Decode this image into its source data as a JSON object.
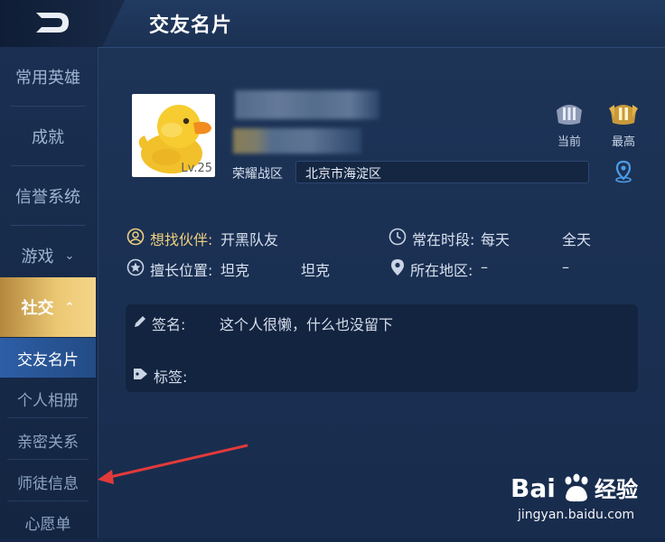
{
  "header": {
    "title": "交友名片"
  },
  "sidebar": {
    "items": [
      {
        "label": "常用英雄"
      },
      {
        "label": "成就"
      },
      {
        "label": "信誉系统"
      },
      {
        "label": "游戏",
        "chevron": "chevron-down-icon"
      },
      {
        "label": "社交",
        "chevron": "chevron-up-icon",
        "active": true
      }
    ],
    "sub_items": [
      {
        "label": "交友名片",
        "active": true
      },
      {
        "label": "个人相册"
      },
      {
        "label": "亲密关系"
      },
      {
        "label": "师徒信息"
      },
      {
        "label": "心愿单"
      }
    ]
  },
  "profile": {
    "level": "Lv.25",
    "zone_label": "荣耀战区",
    "zone_value": "北京市海淀区",
    "ranks": [
      {
        "label": "当前"
      },
      {
        "label": "最高"
      }
    ]
  },
  "info": {
    "partner_label": "想找伙伴:",
    "partner_value": "开黑队友",
    "time_label": "常在时段:",
    "time_value": "每天",
    "time_value2": "全天",
    "position_label": "擅长位置:",
    "position_value": "坦克",
    "position_value2": "坦克",
    "region_label": "所在地区:",
    "region_value": "–",
    "region_value2": "–"
  },
  "panel": {
    "sign_label": "签名:",
    "sign_value": "这个人很懒，什么也没留下",
    "tag_label": "标签:"
  },
  "watermark": {
    "logo_left": "Bai",
    "logo_right": "经验",
    "url": "jingyan.baidu.com"
  },
  "colors": {
    "accent_gold": "#efcf7d",
    "active_tab": "#2d5ea6",
    "arrow": "#e23a3a"
  }
}
